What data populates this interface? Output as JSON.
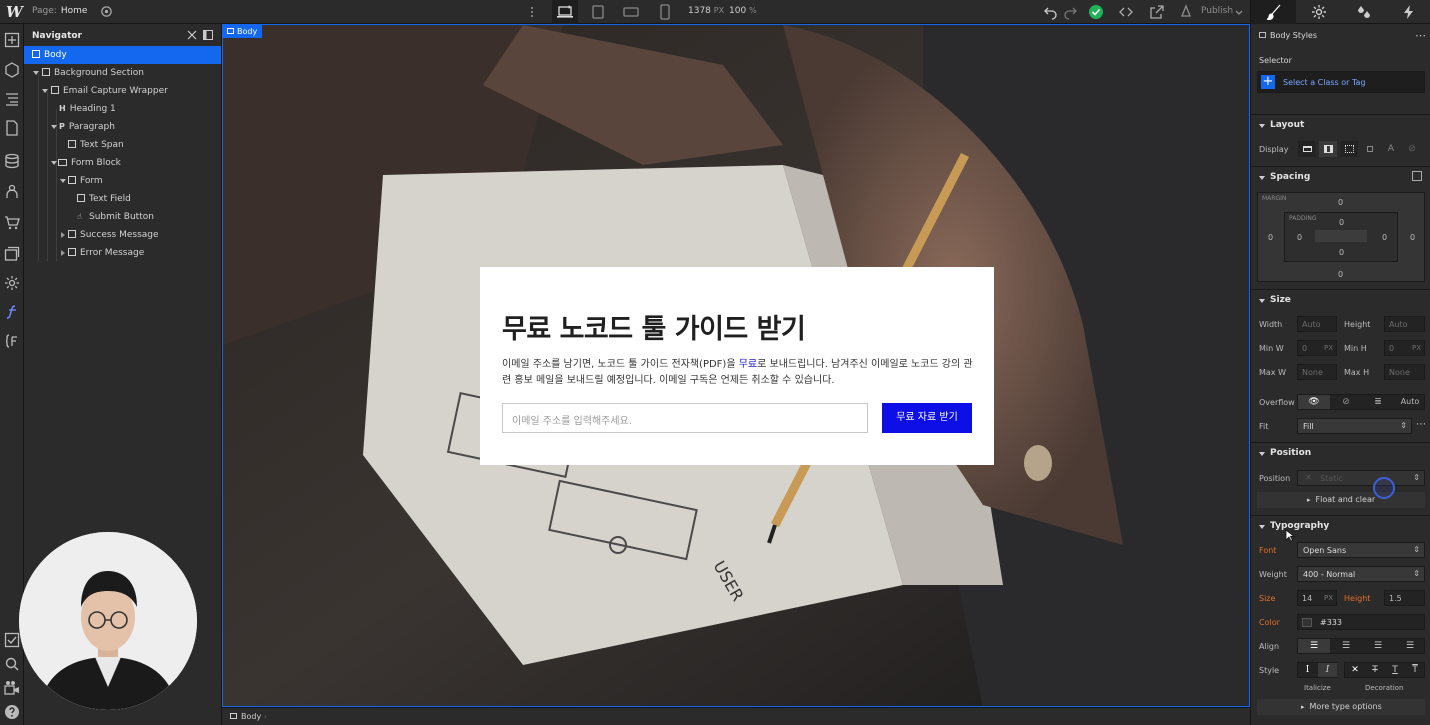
{
  "topbar": {
    "logo": "W",
    "page_label": "Page:",
    "page_name": "Home",
    "width_value": "1378",
    "width_unit": "PX",
    "zoom_value": "100",
    "zoom_unit": "%",
    "publish_label": "Publish"
  },
  "navigator": {
    "title": "Navigator",
    "items": [
      {
        "label": "Body",
        "depth": 0
      },
      {
        "label": "Background Section",
        "depth": 1
      },
      {
        "label": "Email Capture Wrapper",
        "depth": 2
      },
      {
        "label": "Heading 1",
        "depth": 3,
        "icon": "H"
      },
      {
        "label": "Paragraph",
        "depth": 3,
        "icon": "P"
      },
      {
        "label": "Text Span",
        "depth": 4
      },
      {
        "label": "Form Block",
        "depth": 3
      },
      {
        "label": "Form",
        "depth": 4
      },
      {
        "label": "Text Field",
        "depth": 5
      },
      {
        "label": "Submit Button",
        "depth": 5
      },
      {
        "label": "Success Message",
        "depth": 4
      },
      {
        "label": "Error Message",
        "depth": 4
      }
    ]
  },
  "canvas": {
    "body_tag": "Body",
    "card": {
      "heading": "무료 노코드 툴 가이드 받기",
      "para_1": "이메일 주소를 남기면, 노코드 툴 가이드 전자책(PDF)을 ",
      "para_highlight": "무료",
      "para_2": "로 보내드립니다. 남겨주신 이메일로 노코드 강의 관련 홍보 메일을 보내드릴 예정입니다. 이메일 구독은 언제든 취소할 수 있습니다.",
      "email_placeholder": "이메일 주소를 입력해주세요.",
      "button_label": "무료 자료 받기"
    }
  },
  "breadcrumb": {
    "item": "Body"
  },
  "panel": {
    "header": "Body Styles",
    "selector_label": "Selector",
    "selector_placeholder": "Select a Class or Tag",
    "layout": {
      "title": "Layout",
      "display_label": "Display"
    },
    "spacing": {
      "title": "Spacing",
      "margin_label": "MARGIN",
      "padding_label": "PADDING",
      "margin_top": "0",
      "margin_right": "0",
      "margin_bottom": "0",
      "margin_left": "0",
      "padding_top": "0",
      "padding_right": "0",
      "padding_bottom": "0",
      "padding_left": "0"
    },
    "size": {
      "title": "Size",
      "width_label": "Width",
      "width_value": "Auto",
      "height_label": "Height",
      "height_value": "Auto",
      "minw_label": "Min W",
      "minw_value": "0",
      "minw_unit": "PX",
      "minh_label": "Min H",
      "minh_value": "0",
      "minh_unit": "PX",
      "maxw_label": "Max W",
      "maxw_value": "None",
      "maxh_label": "Max H",
      "maxh_value": "None",
      "overflow_label": "Overflow",
      "overflow_auto": "Auto",
      "fit_label": "Fit",
      "fit_value": "Fill"
    },
    "position": {
      "title": "Position",
      "position_label": "Position",
      "position_value": "Static",
      "float_label": "Float and clear"
    },
    "typography": {
      "title": "Typography",
      "font_label": "Font",
      "font_value": "Open Sans",
      "weight_label": "Weight",
      "weight_value": "400 - Normal",
      "size_label": "Size",
      "size_value": "14",
      "size_unit": "PX",
      "height_label": "Height",
      "height_value": "1.5",
      "color_label": "Color",
      "color_value": "#333",
      "align_label": "Align",
      "style_label": "Style",
      "italicize_label": "Italicize",
      "decoration_label": "Decoration",
      "more_label": "More type options"
    }
  },
  "colors": {
    "accent": "#1468ef",
    "cta": "#0e0ee6",
    "success": "#20b15a",
    "override": "#e1702a"
  }
}
